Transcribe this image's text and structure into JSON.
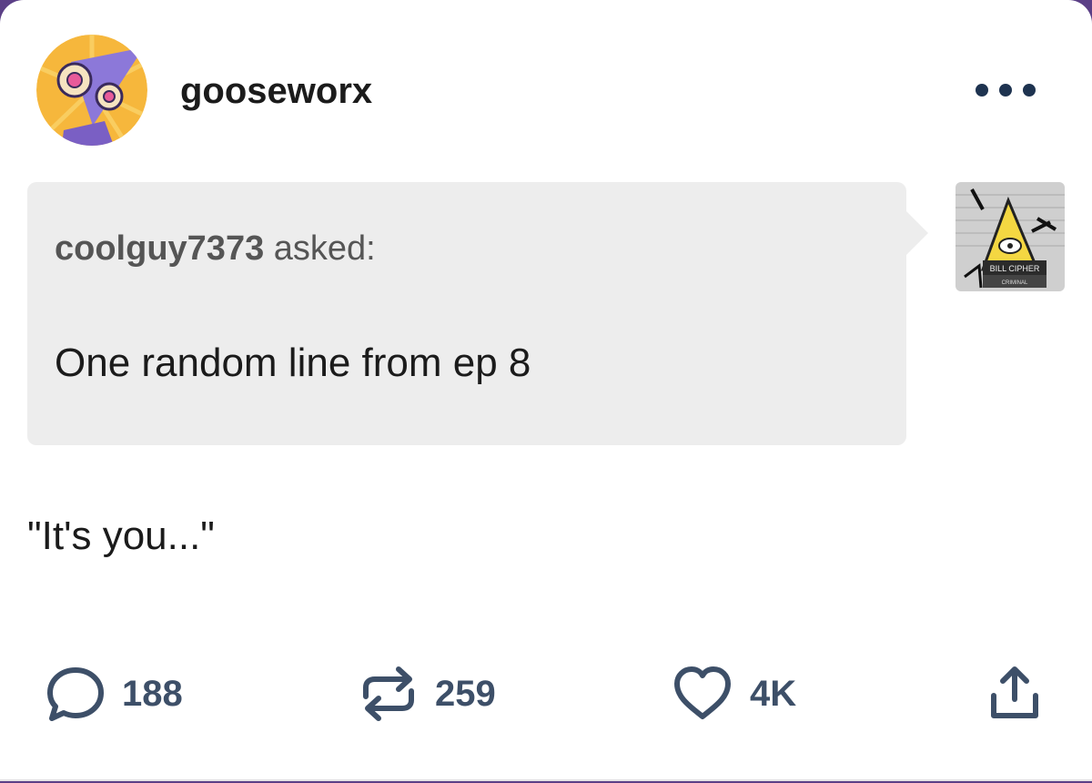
{
  "post": {
    "username": "gooseworx",
    "avatar_icon": "bill-cipher-avatar-icon",
    "more_icon": "more-options-icon"
  },
  "ask": {
    "asker_name": "coolguy7373",
    "asked_label": "asked:",
    "question": "One random line from ep 8",
    "asker_avatar_caption": "BILL CIPHER",
    "asker_avatar_subcaption": "CRIMINAL"
  },
  "answer": {
    "text": "\"It's you...\""
  },
  "actions": {
    "comments_count": "188",
    "reblogs_count": "259",
    "likes_count": "4K",
    "icons": [
      "comment-icon",
      "reblog-icon",
      "heart-icon",
      "share-icon"
    ]
  },
  "colors": {
    "frame": "#5b3f86",
    "ask_background": "#ededed",
    "action_icon": "#3d4f68",
    "more_dots": "#1e3350"
  }
}
